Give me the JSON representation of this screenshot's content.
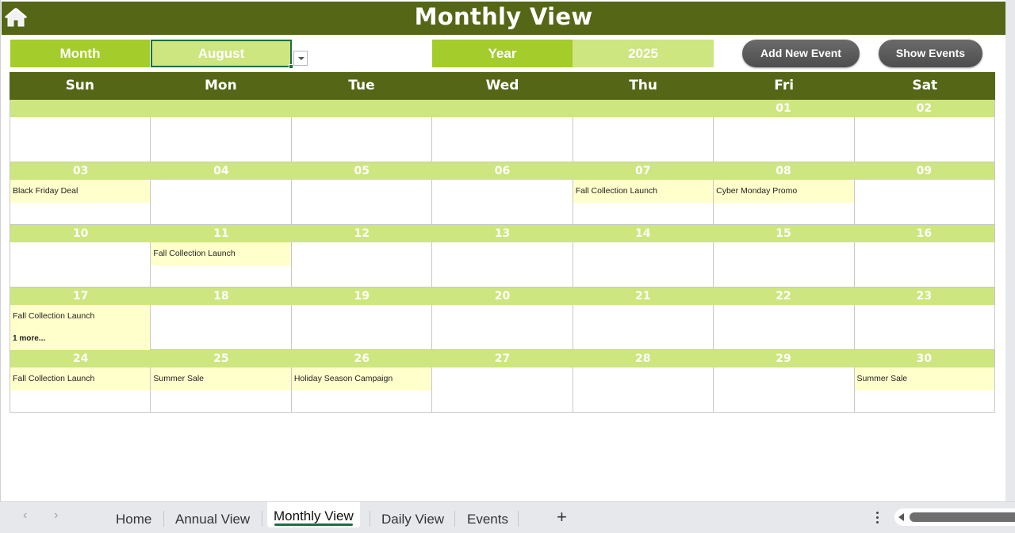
{
  "header": {
    "title": "Monthly View",
    "home_icon": "home-icon"
  },
  "selectors": {
    "month_label": "Month",
    "month_value": "August",
    "year_label": "Year",
    "year_value": "2025"
  },
  "buttons": {
    "add_new_event": "Add New Event",
    "show_events": "Show Events"
  },
  "calendar": {
    "days_of_week": [
      "Sun",
      "Mon",
      "Tue",
      "Wed",
      "Thu",
      "Fri",
      "Sat"
    ],
    "weeks": [
      {
        "days": [
          "",
          "",
          "",
          "",
          "",
          "01",
          "02"
        ],
        "events": [
          "",
          "",
          "",
          "",
          "",
          "",
          ""
        ],
        "more": [
          "",
          "",
          "",
          "",
          "",
          "",
          ""
        ]
      },
      {
        "days": [
          "03",
          "04",
          "05",
          "06",
          "07",
          "08",
          "09"
        ],
        "events": [
          "Black Friday Deal",
          "",
          "",
          "",
          "Fall Collection Launch",
          "Cyber Monday Promo",
          ""
        ],
        "more": [
          "",
          "",
          "",
          "",
          "",
          "",
          ""
        ]
      },
      {
        "days": [
          "10",
          "11",
          "12",
          "13",
          "14",
          "15",
          "16"
        ],
        "events": [
          "",
          "Fall Collection Launch",
          "",
          "",
          "",
          "",
          ""
        ],
        "more": [
          "",
          "",
          "",
          "",
          "",
          "",
          ""
        ]
      },
      {
        "days": [
          "17",
          "18",
          "19",
          "20",
          "21",
          "22",
          "23"
        ],
        "events": [
          "Fall Collection Launch",
          "",
          "",
          "",
          "",
          "",
          ""
        ],
        "more": [
          "1 more...",
          "",
          "",
          "",
          "",
          "",
          ""
        ]
      },
      {
        "days": [
          "24",
          "25",
          "26",
          "27",
          "28",
          "29",
          "30"
        ],
        "events": [
          "Fall Collection Launch",
          "Summer Sale",
          "Holiday Season Campaign",
          "",
          "",
          "",
          "Summer Sale"
        ],
        "more": [
          "",
          "",
          "",
          "",
          "",
          "",
          ""
        ]
      }
    ]
  },
  "sheet_tabs": {
    "tabs": [
      "Home",
      "Annual View",
      "Monthly View",
      "Daily View",
      "Events"
    ],
    "active": "Monthly View",
    "add_label": "+"
  },
  "colors": {
    "header_dark_green": "#556616",
    "label_green": "#a4cc2b",
    "light_green": "#cde67f",
    "event_yellow": "#ffffcc",
    "active_tab_underline": "#1e6e42"
  }
}
